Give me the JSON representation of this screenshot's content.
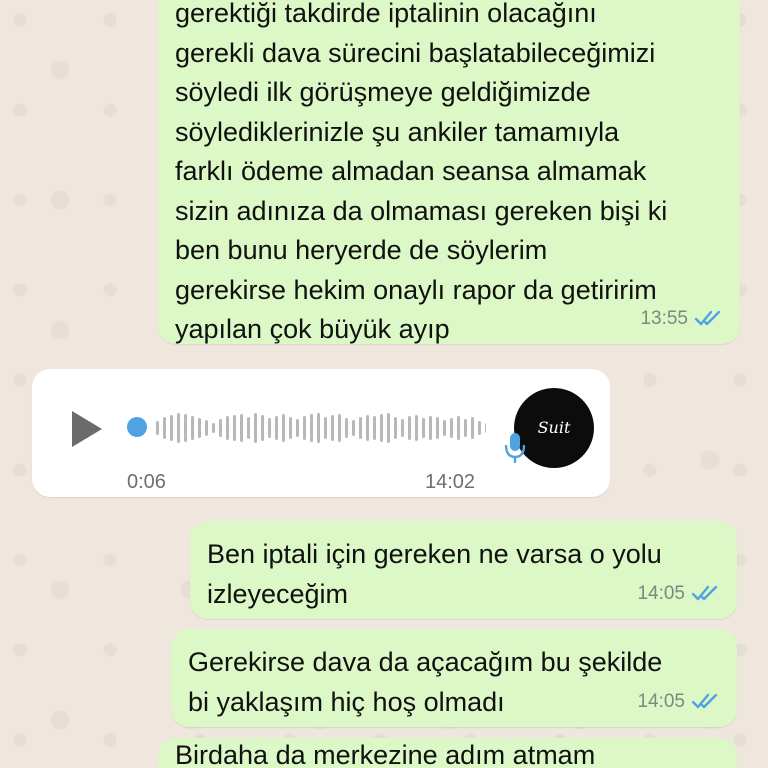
{
  "messages": [
    {
      "lines": [
        "gerektiği takdirde iptalinin olacağını",
        "gerekli dava sürecini başlatabileceğimizi",
        "söyledi ilk görüşmeye geldiğimizde",
        "söylediklerinizle şu ankiler tamamıyla",
        "farklı ödeme almadan seansa almamak",
        "sizin adınıza da olmaması gereken bişi ki",
        "ben bunu heryerde de söylerim",
        "gerekirse hekim onaylı rapor da getiririm",
        "yapılan çok büyük ayıp"
      ],
      "time": "13:55"
    },
    {
      "lines": [
        "Ben iptali için gereken ne varsa o yolu",
        "izleyeceğim"
      ],
      "time": "14:05"
    },
    {
      "lines": [
        "Gerekirse dava da açacağım bu şekilde",
        "bi yaklaşım hiç hoş olmadı"
      ],
      "time": "14:05"
    },
    {
      "lines": [
        "Birdaha da merkezine adım atmam"
      ],
      "time": ""
    }
  ],
  "voice_note": {
    "duration": "0:06",
    "time": "14:02",
    "progress": 0.0,
    "avatar_text": "Suit"
  },
  "colors": {
    "outgoing_bubble": "#dcf8c6",
    "incoming_bubble": "#ffffff",
    "read_ticks": "#4fa3e0",
    "wallpaper": "#efe7dd",
    "mic_icon": "#4fa3e0"
  },
  "icons": {
    "play": "play-icon",
    "mic": "microphone-icon",
    "ticks": "double-check-icon"
  }
}
